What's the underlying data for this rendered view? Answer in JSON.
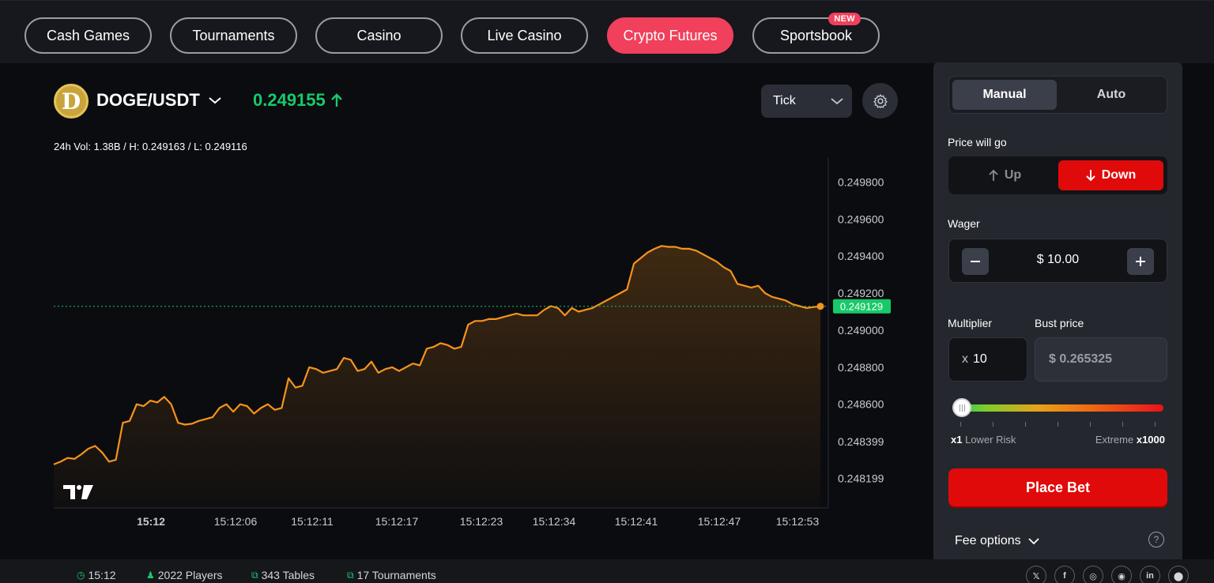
{
  "nav": {
    "tabs": [
      {
        "label": "Cash Games"
      },
      {
        "label": "Tournaments"
      },
      {
        "label": "Casino"
      },
      {
        "label": "Live Casino"
      },
      {
        "label": "Crypto Futures",
        "active": true
      },
      {
        "label": "Sportsbook",
        "badge": "NEW"
      }
    ]
  },
  "market": {
    "coin_letter": "D",
    "pair": "DOGE/USDT",
    "price": "0.249155",
    "stats": "24h Vol: 1.38B / H: 0.249163 / L: 0.249116",
    "interval": "Tick"
  },
  "chart_data": {
    "type": "area",
    "series": [
      {
        "values": [
          0.248275,
          0.24829,
          0.24831,
          0.248305,
          0.24833,
          0.24836,
          0.248375,
          0.24834,
          0.24829,
          0.2483,
          0.2485,
          0.24851,
          0.2486,
          0.24859,
          0.24862,
          0.24861,
          0.24864,
          0.2486,
          0.2485,
          0.24849,
          0.248495,
          0.24851,
          0.24852,
          0.24853,
          0.24858,
          0.2486,
          0.24856,
          0.2486,
          0.24859,
          0.24855,
          0.24858,
          0.2486,
          0.24857,
          0.24858,
          0.24874,
          0.24869,
          0.2487,
          0.2488,
          0.24879,
          0.24877,
          0.24878,
          0.24879,
          0.24885,
          0.24884,
          0.24878,
          0.24879,
          0.24883,
          0.24877,
          0.24879,
          0.2488,
          0.24878,
          0.2488,
          0.24882,
          0.24881,
          0.2489,
          0.24891,
          0.24893,
          0.24892,
          0.2489,
          0.24891,
          0.24903,
          0.24905,
          0.24905,
          0.24906,
          0.24906,
          0.24907,
          0.24908,
          0.24909,
          0.24908,
          0.24908,
          0.24908,
          0.24911,
          0.24913,
          0.24912,
          0.24908,
          0.24912,
          0.2491,
          0.24911,
          0.24912,
          0.24914,
          0.24916,
          0.24918,
          0.2492,
          0.24922,
          0.24936,
          0.24939,
          0.24942,
          0.24944,
          0.249455,
          0.24945,
          0.24945,
          0.24944,
          0.24944,
          0.24943,
          0.24941,
          0.24939,
          0.24937,
          0.24934,
          0.24932,
          0.24925,
          0.24924,
          0.24923,
          0.24924,
          0.2492,
          0.24918,
          0.24917,
          0.24916,
          0.24914,
          0.24913,
          0.24912,
          0.249125,
          0.249129
        ]
      }
    ],
    "y_ticks": [
      "0.249800",
      "0.249600",
      "0.249400",
      "0.249200",
      "0.249000",
      "0.248800",
      "0.248600",
      "0.248399",
      "0.248199"
    ],
    "x_ticks": [
      "15:12",
      "15:12:06",
      "15:12:11",
      "15:12:17",
      "15:12:23",
      "15:12:34",
      "15:12:41",
      "15:12:47",
      "15:12:53"
    ],
    "current_price_label": "0.249129",
    "ylim": [
      0.24804,
      0.24993
    ],
    "line_color": "#f7931a",
    "marker_color": "#18c96a"
  },
  "panel": {
    "modes": [
      "Manual",
      "Auto"
    ],
    "active_mode": "Manual",
    "direction_label": "Price will go",
    "up_label": "Up",
    "down_label": "Down",
    "wager_label": "Wager",
    "wager_value": "$ 10.00",
    "multiplier_label": "Multiplier",
    "bust_label": "Bust price",
    "multiplier_prefix": "x",
    "multiplier_value": "10",
    "bust_value": "$ 0.265325",
    "risk_low_mult": "x1",
    "risk_low_label": "Lower Risk",
    "risk_high_label": "Extreme",
    "risk_high_mult": "x1000",
    "place_bet": "Place Bet",
    "fee_options": "Fee options",
    "help": "?"
  },
  "footer": {
    "time": "15:12",
    "players": "2022 Players",
    "tables": "343 Tables",
    "tournaments": "17 Tournaments",
    "socials": [
      "𝕏",
      "f",
      "◎",
      "◉",
      "in",
      "⬤"
    ]
  },
  "colors": {
    "accent": "#f0405c",
    "up": "#18c96a",
    "down": "#e00a0a"
  }
}
